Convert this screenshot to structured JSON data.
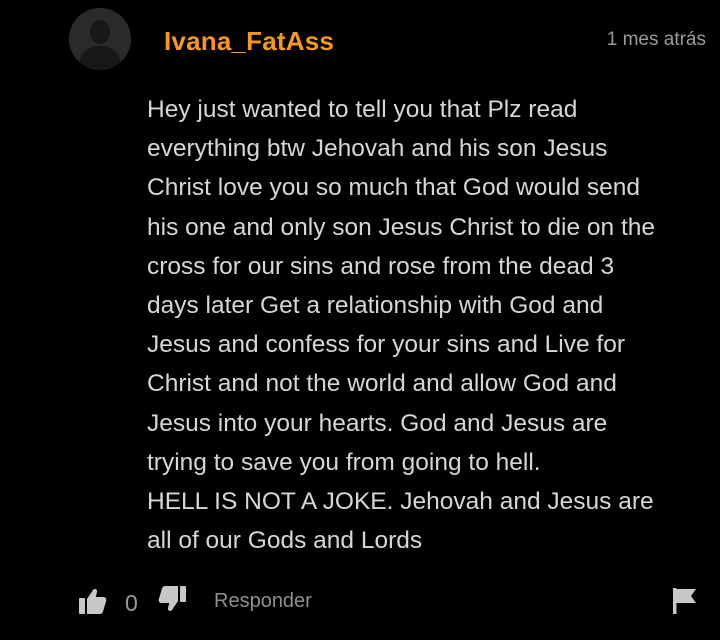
{
  "comment": {
    "username": "Ivana_FatAss",
    "timestamp": "1 mes atrás",
    "body_lines": [
      "Hey just wanted to tell you that Plz read",
      "everything btw Jehovah and his son Jesus",
      "Christ love you so much that God would send",
      "his one and only son Jesus Christ to die on the",
      "cross for our sins and rose from the dead 3",
      "days later Get a relationship with God and",
      "Jesus and confess for your sins and Live for",
      "Christ and not the world and allow God and",
      "Jesus into your hearts. God and Jesus are",
      "trying to save you from going to hell.",
      "HELL IS NOT A JOKE. Jehovah and Jesus are",
      "all of our Gods and Lords"
    ]
  },
  "actions": {
    "like_count": "0",
    "reply_label": "Responder"
  },
  "icons": {
    "avatar": "default-user-avatar",
    "like": "thumbs-up-icon",
    "dislike": "thumbs-down-icon",
    "flag": "flag-icon"
  },
  "colors": {
    "background": "#000000",
    "username": "#f7971d",
    "body_text": "#d6d6d6",
    "muted_text": "#9a9a9a",
    "icon": "#c8c8c8"
  }
}
